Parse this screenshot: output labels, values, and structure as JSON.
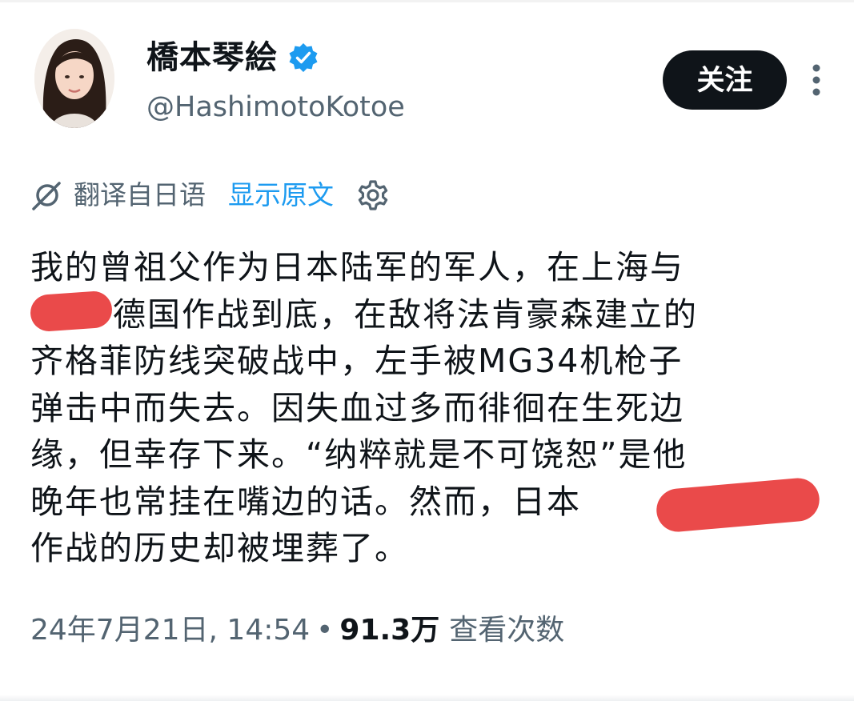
{
  "author": {
    "display_name": "橋本琴絵",
    "handle": "@HashimotoKotoe",
    "verified": true
  },
  "follow_button": {
    "label": "关注"
  },
  "translation": {
    "label": "翻译自日语",
    "show_original": "显示原文"
  },
  "tweet": {
    "lines": [
      "我的曾祖父作为日本陆军的军人，在上海与",
      "德国作战到底，在敌将法肯豪森建立的",
      "齐格菲防线突破战中，左手被MG34机枪子",
      "弹击中而失去。因失血过多而徘徊在生死边",
      "缘，但幸存下来。“纳粹就是不可饶恕”是他",
      "晚年也常挂在嘴边的话。然而，日本",
      "作战的历史却被埋葬了。"
    ]
  },
  "meta": {
    "timestamp": "24年7月21日, 14:54",
    "separator": "•",
    "views_count": "91.3万",
    "views_label": "查看次数"
  },
  "icons": {
    "verified": "verified-badge-icon",
    "more": "more-vertical-icon",
    "translate": "translate-icon",
    "settings": "gear-icon"
  },
  "colors": {
    "accent": "#1d9bf0",
    "secondary_text": "#536471",
    "redaction": "#ea4a4a"
  }
}
